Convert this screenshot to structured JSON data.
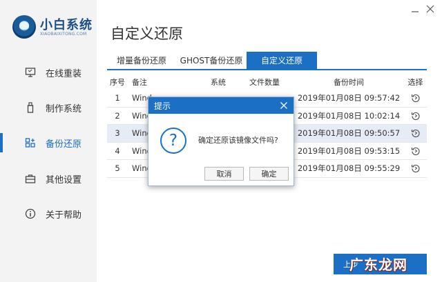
{
  "app": {
    "brand": "小白系统",
    "brand_sub": "XIAOBAIXITONG.COM"
  },
  "sidebar": {
    "items": [
      {
        "label": "在线重装",
        "icon": "monitor-icon"
      },
      {
        "label": "制作系统",
        "icon": "usb-icon"
      },
      {
        "label": "备份还原",
        "icon": "restore-grid-icon",
        "active": true
      },
      {
        "label": "其他设置",
        "icon": "briefcase-icon"
      },
      {
        "label": "关于帮助",
        "icon": "info-icon"
      }
    ]
  },
  "page": {
    "title": "自定义还原"
  },
  "tabs": [
    {
      "label": "增量备份还原"
    },
    {
      "label": "GHOST备份还原"
    },
    {
      "label": "自定义还原",
      "active": true
    }
  ],
  "table": {
    "headers": {
      "idx": "序号",
      "note": "备注",
      "system": "系统",
      "count": "文件数量",
      "time": "备份时间",
      "select": "选择"
    },
    "rows": [
      {
        "idx": "1",
        "note": "Wind",
        "time": "2019年01月08日 09:57:42"
      },
      {
        "idx": "2",
        "note": "Wind",
        "time": "2019年01月08日 10:02:14"
      },
      {
        "idx": "3",
        "note": "Wind",
        "time": "2019年01月08日 09:50:57"
      },
      {
        "idx": "4",
        "note": "Wind",
        "time": "2019年01月08日 09:53:15"
      },
      {
        "idx": "5",
        "note": "Wind",
        "time": "2019年01月08日 09:55:29"
      }
    ]
  },
  "dialog": {
    "title": "提示",
    "message": "确定还原该镜像文件吗?",
    "cancel": "取消",
    "ok": "确定"
  },
  "footer": {
    "prev_label": "上步"
  },
  "watermark": "广东龙网",
  "colors": {
    "accent": "#1b6fc4",
    "sidebar_bg": "#f3f3f3"
  }
}
